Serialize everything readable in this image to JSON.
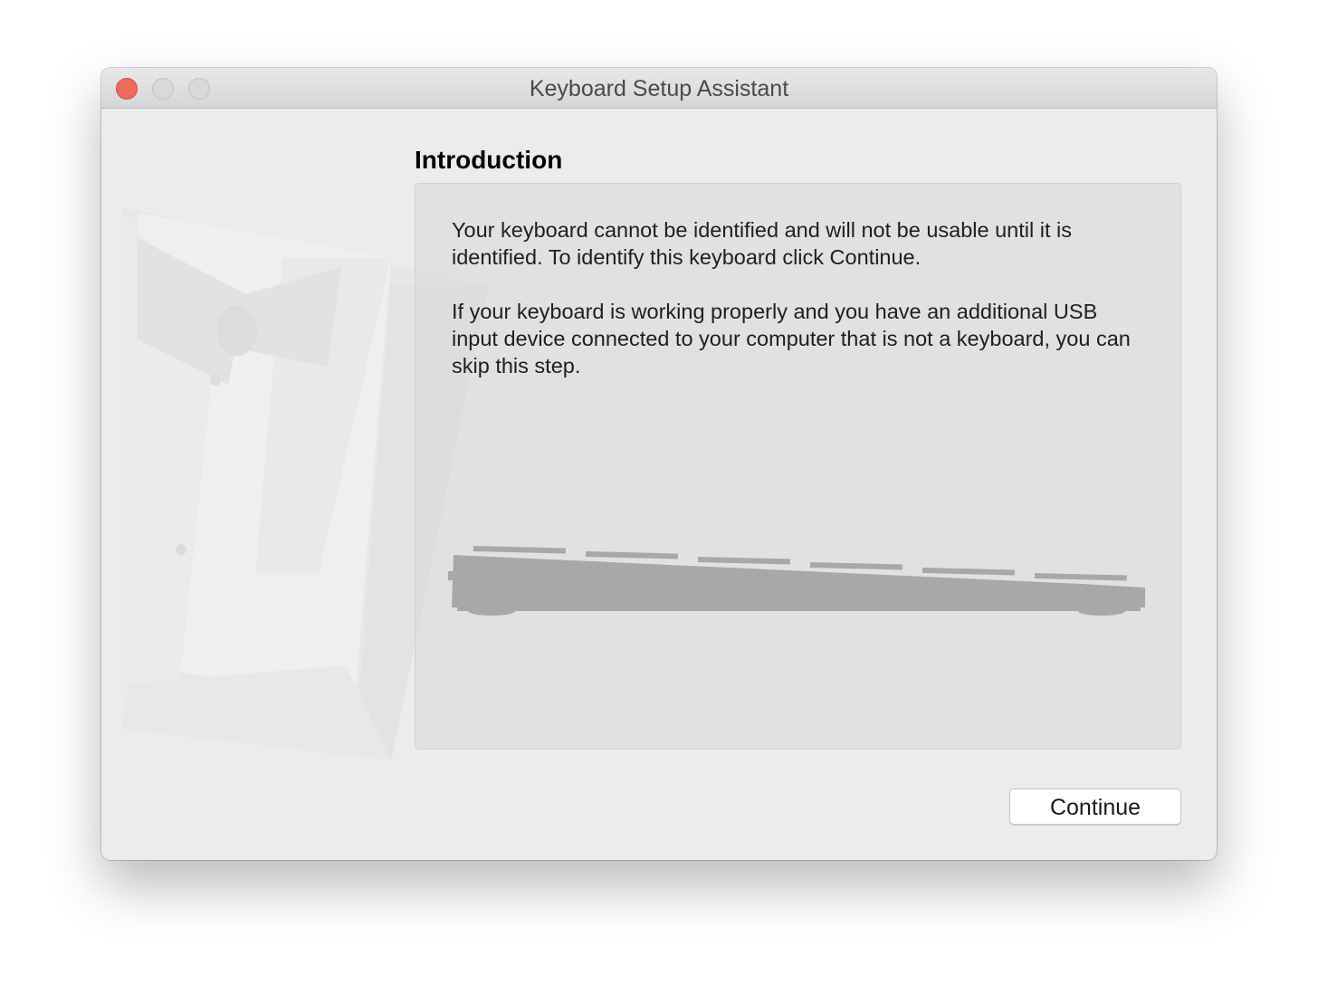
{
  "window": {
    "title": "Keyboard Setup Assistant"
  },
  "titlebar": {
    "close_icon": "close-icon",
    "minimize_icon": "minimize-icon",
    "zoom_icon": "zoom-icon",
    "colors": {
      "close": "#ed6a5e",
      "inactive": "#d9d9d9"
    }
  },
  "main": {
    "heading": "Introduction",
    "paragraph1": "Your keyboard cannot be identified and will not be usable until it is identified. To identify this keyboard click Continue.",
    "paragraph2": "If your keyboard is working properly and you have an additional USB input device connected to your computer that is not a keyboard, you can skip this step.",
    "illustration_icon": "keyboard-side-icon"
  },
  "sidebar": {
    "artwork_icon": "tuxedo-artwork-icon"
  },
  "footer": {
    "continue_label": "Continue"
  }
}
